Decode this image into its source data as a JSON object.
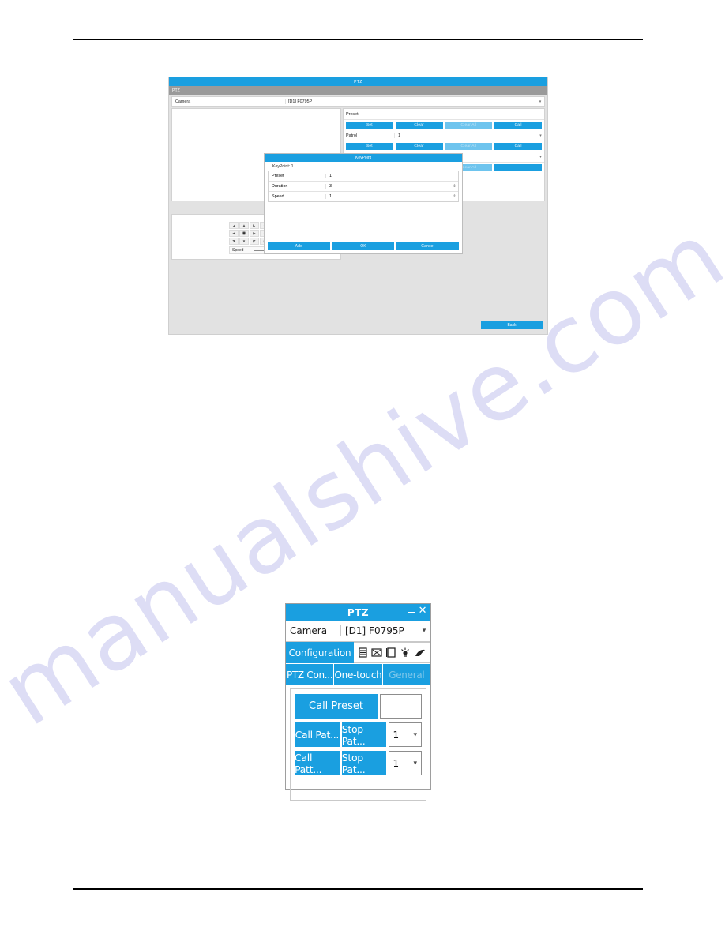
{
  "watermark": "manualshive.com",
  "figure_top": {
    "window_title": "PTZ",
    "sub_title": "PTZ",
    "camera": {
      "label": "Camera",
      "value": "[D1] F0795P",
      "caret": "chevron-down"
    },
    "sections": [
      {
        "label": "Preset",
        "value": "",
        "buttons": [
          {
            "label": "Set",
            "disabled": false
          },
          {
            "label": "Clear",
            "disabled": false
          },
          {
            "label": "Clear All",
            "disabled": true
          },
          {
            "label": "Call",
            "disabled": false
          }
        ]
      },
      {
        "label": "Patrol",
        "value": "1",
        "buttons": [
          {
            "label": "Set",
            "disabled": false
          },
          {
            "label": "Clear",
            "disabled": false
          },
          {
            "label": "Clear All",
            "disabled": true
          },
          {
            "label": "Call",
            "disabled": false
          }
        ]
      },
      {
        "label": "",
        "value": "",
        "buttons": [
          {
            "label": "",
            "disabled": false
          },
          {
            "label": "",
            "disabled": false
          },
          {
            "label": "Clear All",
            "disabled": true
          },
          {
            "label": "",
            "disabled": false
          }
        ]
      }
    ],
    "control_pad": {
      "speed_label": "Speed",
      "center_icon": "pan-center-icon",
      "arrows": [
        "arrow-up-left",
        "arrow-up",
        "arrow-up-right",
        "zoom-in",
        "arrow-left",
        "pan-center",
        "arrow-right",
        "zoom-out",
        "arrow-down-left",
        "arrow-down",
        "arrow-down-right",
        "focus"
      ]
    },
    "back_button": "Back"
  },
  "keypoint_dialog": {
    "title": "KeyPoint",
    "subtitle": "KeyPoint: 1",
    "fields": [
      {
        "name": "Preset",
        "value": "1",
        "spinner": false
      },
      {
        "name": "Duration",
        "value": "3",
        "spinner": true
      },
      {
        "name": "Speed",
        "value": "1",
        "spinner": true
      }
    ],
    "buttons": [
      {
        "label": "Add"
      },
      {
        "label": "OK"
      },
      {
        "label": "Cancel"
      }
    ]
  },
  "figure_bottom": {
    "title": "PTZ",
    "minimize_icon": "minimize-icon",
    "close_icon": "close-icon",
    "camera": {
      "label": "Camera",
      "value": "[D1] F0795P"
    },
    "configuration_button": "Configuration",
    "toolbar_icons": [
      "menu-icon",
      "three-d-zoom-icon",
      "zoom-frame-icon",
      "light-icon",
      "wiper-icon"
    ],
    "tabs": [
      {
        "label": "PTZ Con...",
        "dim": false
      },
      {
        "label": "One-touch",
        "dim": false
      },
      {
        "label": "General",
        "dim": true
      }
    ],
    "rows": [
      {
        "type": "preset",
        "button": "Call Preset",
        "input_value": ""
      },
      {
        "type": "patrol",
        "left_button": "Call Pat...",
        "right_button": "Stop Pat...",
        "select_value": "1"
      },
      {
        "type": "pattern",
        "left_button": "Call Patt...",
        "right_button": "Stop Pat...",
        "select_value": "1"
      }
    ]
  },
  "colors": {
    "accent": "#1a9fe0",
    "accent_disabled": "#6ec4ee",
    "window_bg": "#e2e2e2",
    "subbar": "#9a9a9a",
    "watermark": "#c9c9ef"
  }
}
